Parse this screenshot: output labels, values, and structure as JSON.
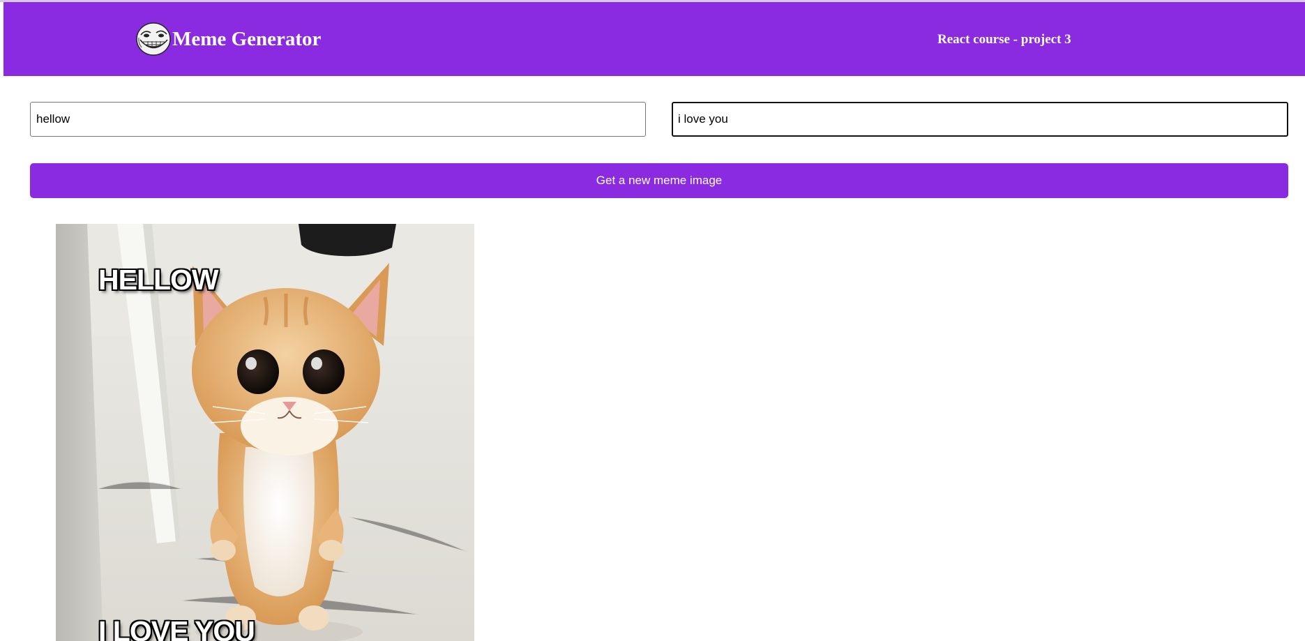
{
  "header": {
    "logo_icon": "troll-face-icon",
    "title": "Meme Generator",
    "course_label": "React course - project 3",
    "background_color": "#8a2be2"
  },
  "form": {
    "top_text_value": "hellow",
    "bottom_text_value": "i love you",
    "submit_label": "Get a new meme image",
    "button_color": "#8a2be2"
  },
  "meme": {
    "image_subject": "kitten-standing-photo",
    "top_text": "hellow",
    "bottom_text": "i love you"
  }
}
